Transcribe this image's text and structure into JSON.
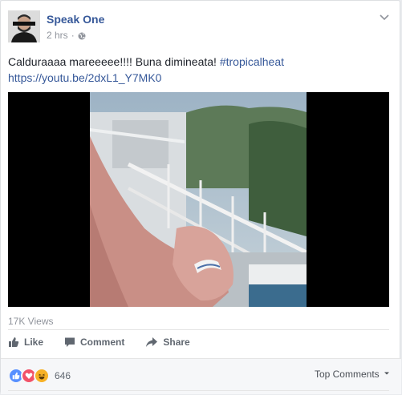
{
  "post": {
    "author": "Speak One",
    "time": "2 hrs",
    "text": {
      "main": "Calduraaaa mareeeee!!!! Buna dimineata! ",
      "hashtag": "#tropicalheat",
      "link": "https://youtu.be/2dxL1_Y7MK0"
    },
    "views": "17K Views"
  },
  "actions": {
    "like": "Like",
    "comment": "Comment",
    "share": "Share"
  },
  "reactions": {
    "count": "646",
    "types": [
      "like",
      "love",
      "haha"
    ]
  },
  "top_comments": "Top Comments",
  "colors": {
    "link": "#365899",
    "like": "#5890ff",
    "love": "#f25268",
    "haha": "#f7b125"
  }
}
